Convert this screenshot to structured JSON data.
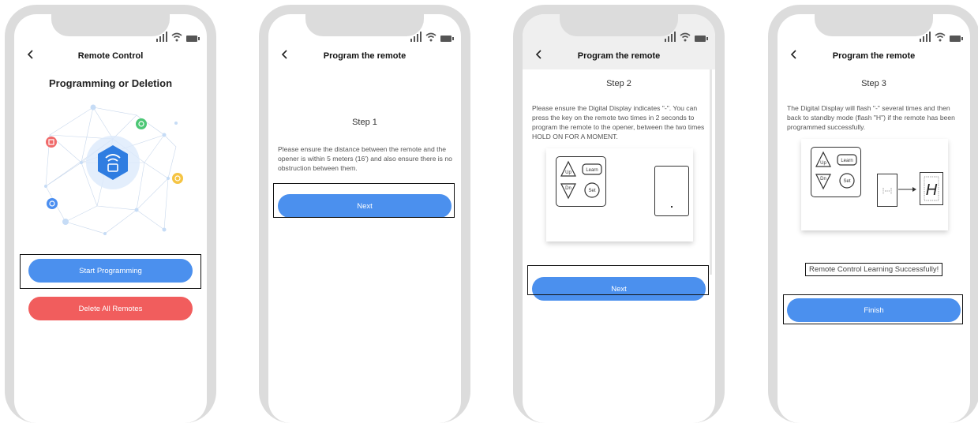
{
  "screens": [
    {
      "title": "Remote Control",
      "heading": "Programming or Deletion",
      "primary_button": "Start Programming",
      "secondary_button": "Delete All Remotes"
    },
    {
      "title": "Program the remote",
      "step": "Step 1",
      "text": "Please ensure the distance between the remote and the opener is within 5 meters (16') and also ensure there is no obstruction between them.",
      "primary_button": "Next"
    },
    {
      "title": "Program the remote",
      "step": "Step 2",
      "text": "Please ensure the Digital Display indicates \"-\". You can press the key on the remote two times in 2 seconds to program the remote to the opener, between the two times HOLD ON FOR A MOMENT.",
      "remote_keys": [
        "Up",
        "Learn",
        "Dn",
        "Set"
      ],
      "primary_button": "Next"
    },
    {
      "title": "Program the remote",
      "step": "Step 3",
      "text": "The Digital Display will flash \"-\" several times and then back to standby mode (flash \"H\") if the remote has been programmed successfully.",
      "remote_keys": [
        "Up",
        "Learn",
        "Dn",
        "Set"
      ],
      "display_char": "H",
      "success_message": "Remote Control Learning Successfully!",
      "primary_button": "Finish"
    }
  ],
  "colors": {
    "primary": "#4b90ee",
    "danger": "#f15d5d",
    "frame": "#dcdcdc"
  },
  "icons": [
    "back-arrow-icon",
    "signal-icon",
    "wifi-icon",
    "battery-icon",
    "remote-hub-icon"
  ]
}
